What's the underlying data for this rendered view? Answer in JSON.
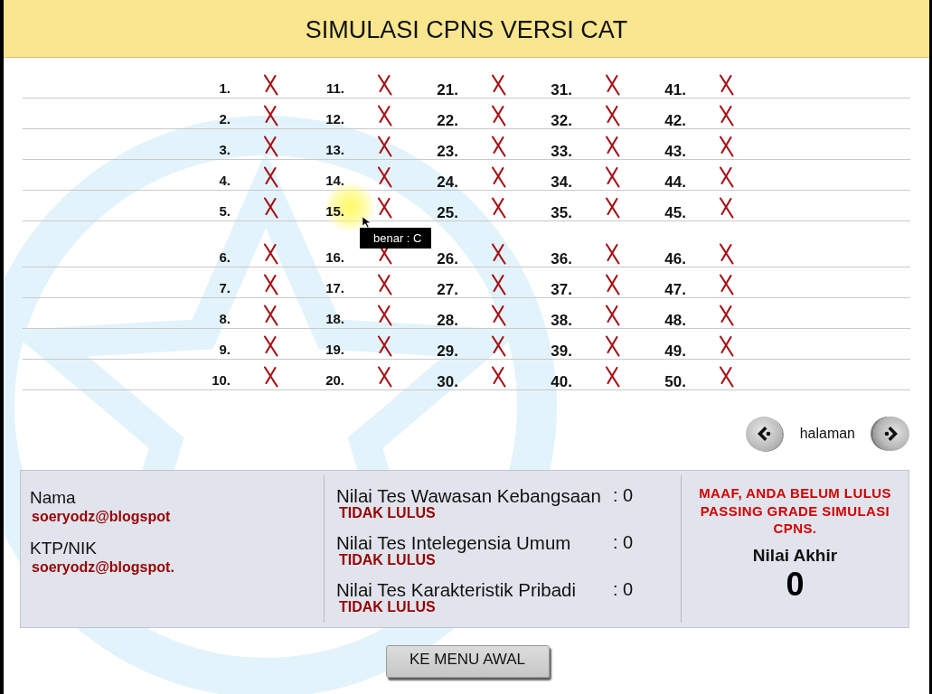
{
  "header": {
    "title": "SIMULASI CPNS VERSI CAT"
  },
  "answer_blocks": [
    {
      "rows": [
        {
          "cells": [
            {
              "number": "1.",
              "correct": false
            },
            {
              "number": "11.",
              "correct": false
            },
            {
              "number": "21.",
              "correct": false
            },
            {
              "number": "31.",
              "correct": false
            },
            {
              "number": "41.",
              "correct": false
            }
          ]
        },
        {
          "cells": [
            {
              "number": "2.",
              "correct": false
            },
            {
              "number": "12.",
              "correct": false
            },
            {
              "number": "22.",
              "correct": false
            },
            {
              "number": "32.",
              "correct": false
            },
            {
              "number": "42.",
              "correct": false
            }
          ]
        },
        {
          "cells": [
            {
              "number": "3.",
              "correct": false
            },
            {
              "number": "13.",
              "correct": false
            },
            {
              "number": "23.",
              "correct": false
            },
            {
              "number": "33.",
              "correct": false
            },
            {
              "number": "43.",
              "correct": false
            }
          ]
        },
        {
          "cells": [
            {
              "number": "4.",
              "correct": false
            },
            {
              "number": "14.",
              "correct": false
            },
            {
              "number": "24.",
              "correct": false
            },
            {
              "number": "34.",
              "correct": false
            },
            {
              "number": "44.",
              "correct": false
            }
          ]
        },
        {
          "cells": [
            {
              "number": "5.",
              "correct": false
            },
            {
              "number": "15.",
              "correct": false,
              "tooltip": "benar : C"
            },
            {
              "number": "25.",
              "correct": false
            },
            {
              "number": "35.",
              "correct": false
            },
            {
              "number": "45.",
              "correct": false
            }
          ]
        }
      ]
    },
    {
      "rows": [
        {
          "cells": [
            {
              "number": "6.",
              "correct": false
            },
            {
              "number": "16.",
              "correct": false
            },
            {
              "number": "26.",
              "correct": false
            },
            {
              "number": "36.",
              "correct": false
            },
            {
              "number": "46.",
              "correct": false
            }
          ]
        },
        {
          "cells": [
            {
              "number": "7.",
              "correct": false
            },
            {
              "number": "17.",
              "correct": false
            },
            {
              "number": "27.",
              "correct": false
            },
            {
              "number": "37.",
              "correct": false
            },
            {
              "number": "47.",
              "correct": false
            }
          ]
        },
        {
          "cells": [
            {
              "number": "8.",
              "correct": false
            },
            {
              "number": "18.",
              "correct": false
            },
            {
              "number": "28.",
              "correct": false
            },
            {
              "number": "38.",
              "correct": false
            },
            {
              "number": "48.",
              "correct": false
            }
          ]
        },
        {
          "cells": [
            {
              "number": "9.",
              "correct": false
            },
            {
              "number": "19.",
              "correct": false
            },
            {
              "number": "29.",
              "correct": false
            },
            {
              "number": "39.",
              "correct": false
            },
            {
              "number": "49.",
              "correct": false
            }
          ]
        },
        {
          "cells": [
            {
              "number": "10.",
              "correct": false
            },
            {
              "number": "20.",
              "correct": false
            },
            {
              "number": "30.",
              "correct": false
            },
            {
              "number": "40.",
              "correct": false
            },
            {
              "number": "50.",
              "correct": false
            }
          ]
        }
      ]
    }
  ],
  "pagination": {
    "label": "halaman"
  },
  "summary": {
    "identity": [
      {
        "label": "Nama",
        "value": "soeryodz@blogspot"
      },
      {
        "label": "KTP/NIK",
        "value": "soeryodz@blogspot."
      }
    ],
    "scores": [
      {
        "label": "Nilai Tes Wawasan Kebangsaan",
        "value": ": 0",
        "status": "TIDAK LULUS"
      },
      {
        "label": "Nilai Tes Intelegensia Umum",
        "value": ": 0",
        "status": "TIDAK LULUS"
      },
      {
        "label": "Nilai Tes Karakteristik Pribadi",
        "value": ": 0",
        "status": "TIDAK LULUS"
      }
    ],
    "result": {
      "message": "MAAF, ANDA BELUM LULUS PASSING GRADE SIMULASI CPNS.",
      "final_label": "Nilai Akhir",
      "final_score": "0"
    }
  },
  "menu_button": {
    "label": "KE MENU AWAL"
  }
}
